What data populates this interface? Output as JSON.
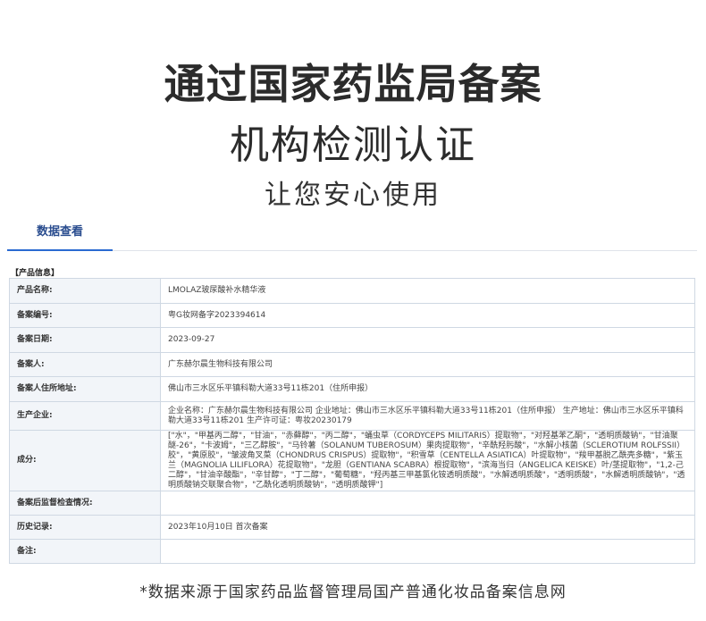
{
  "hero": {
    "line1": "通过国家药监局备案",
    "line2": "机构检测认证",
    "line3": "让您安心使用"
  },
  "tab": {
    "label": "数据查看"
  },
  "section": {
    "title": "【产品信息】"
  },
  "rows": [
    {
      "key": "产品名称:",
      "value": "LMOLAZ玻尿酸补水精华液"
    },
    {
      "key": "备案编号:",
      "value": "粤G妆网备字2023394614"
    },
    {
      "key": "备案日期:",
      "value": "2023-09-27"
    },
    {
      "key": "备案人:",
      "value": "广东赫尔晨生物科技有限公司"
    },
    {
      "key": "备案人住所地址:",
      "value": "佛山市三水区乐平镇科勒大道33号11栋201（住所申报）"
    },
    {
      "key": "生产企业:",
      "value": "企业名称：广东赫尔晨生物科技有限公司 企业地址：佛山市三水区乐平镇科勒大道33号11栋201（住所申报） 生产地址：佛山市三水区乐平镇科勒大道33号11栋201 生产许可证：粤妆20230179"
    },
    {
      "key": "成分:",
      "value": "[\"水\"，\"甲基丙二醇\"，\"甘油\"，\"赤藓醇\"，\"丙二醇\"，\"蛹虫草（CORDYCEPS MILITARIS）提取物\"，\"对羟基苯乙酮\"，\"透明质酸钠\"，\"甘油聚醚-26\"，\"卡波姆\"，\"三乙醇胺\"，\"马铃薯（SOLANUM TUBEROSUM）果肉提取物\"，\"辛酰羟肟酸\"，\"水解小核菌（SCLEROTIUM ROLFSSII）胶\"，\"黄原胶\"，\"皱波角叉菜（CHONDRUS CRISPUS）提取物\"，\"积雪草（CENTELLA ASIATICA）叶提取物\"，\"羧甲基脱乙酰壳多糖\"，\"紫玉兰（MAGNOLIA LILIFLORA）花提取物\"，\"龙胆（GENTIANA SCABRA）根提取物\"，\"滨海当归（ANGELICA KEISKE）叶/茎提取物\"，\"1,2-己二醇\"，\"甘油辛酸酯\"，\"辛甘醇\"，\"丁二醇\"，\"葡萄糖\"，\"羟丙基三甲基氯化铵透明质酸\"，\"水解透明质酸\"，\"透明质酸\"，\"水解透明质酸钠\"，\"透明质酸钠交联聚合物\"，\"乙酰化透明质酸钠\"，\"透明质酸钾\"]"
    },
    {
      "key": "备案后监督检查情况:",
      "value": ""
    },
    {
      "key": "历史记录:",
      "value": "2023年10月10日 首次备案"
    },
    {
      "key": "备注:",
      "value": ""
    }
  ],
  "footer": {
    "note": "*数据来源于国家药品监督管理局国产普通化妆品备案信息网"
  }
}
